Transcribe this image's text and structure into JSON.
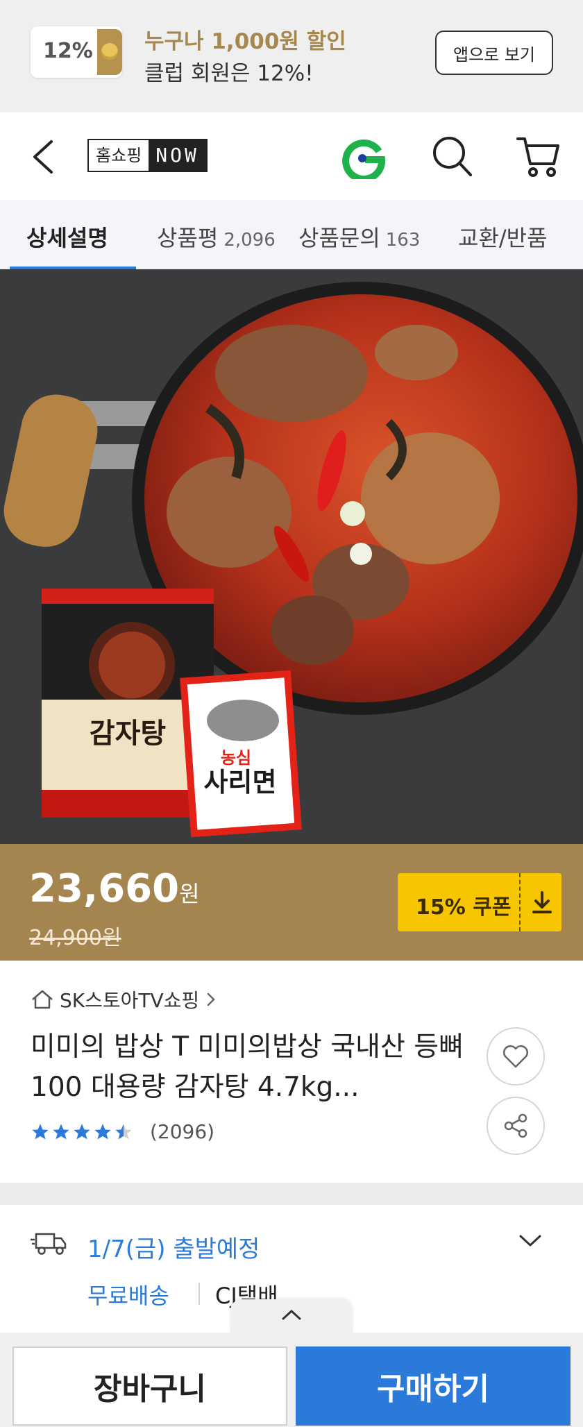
{
  "promo": {
    "badge_percent": "12%",
    "headline": "누구나 1,000원 할인",
    "subline": "클럽 회원은 12%!",
    "app_button": "앱으로 보기"
  },
  "header": {
    "logo_korean": "홈쇼핑",
    "logo_now": "NOW",
    "icons": [
      "back-icon",
      "g-icon",
      "search-icon",
      "cart-icon"
    ]
  },
  "tabs": [
    {
      "label": "상세설명",
      "count": ""
    },
    {
      "label": "상품평",
      "count": "2,096"
    },
    {
      "label": "상품문의",
      "count": "163"
    },
    {
      "label": "교환/반품",
      "count": ""
    }
  ],
  "product_image": {
    "pack1_label": "감자탕",
    "pack2_brand": "농심",
    "pack2_label": "사리면"
  },
  "price": {
    "current": "23,660",
    "currency": "원",
    "original": "24,900원",
    "coupon_label": "15% 쿠폰"
  },
  "product": {
    "seller": "SK스토아TV쇼핑",
    "title": "미미의 밥상 T 미미의밥상 국내산 등뼈100 대용량 감자탕 4.7kg...",
    "rating": 4.5,
    "review_count": "(2096)"
  },
  "delivery": {
    "date": "1/7(금) 출발예정",
    "free_shipping": "무료배송",
    "courier": "CJ택배"
  },
  "bottom": {
    "cart_button": "장바구니",
    "buy_button": "구매하기"
  },
  "colors": {
    "accent_blue": "#2b7ad9",
    "gold": "#a4844f",
    "coupon_yellow": "#f7c600",
    "g_green": "#1fb24a"
  }
}
